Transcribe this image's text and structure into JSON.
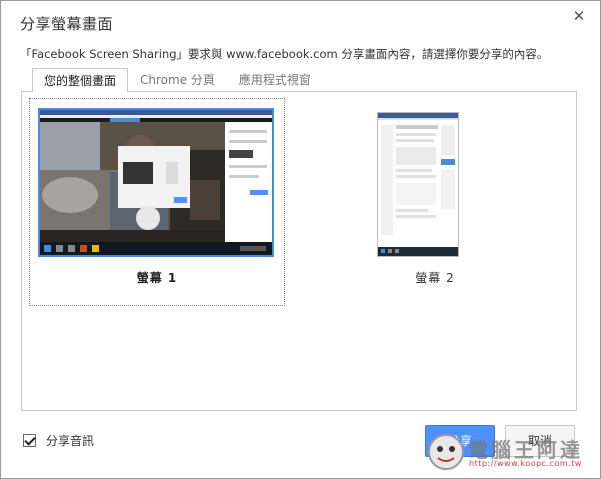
{
  "dialog": {
    "title": "分享螢幕畫面",
    "description": "「Facebook Screen Sharing」要求與 www.facebook.com 分享畫面內容，請選擇你要分享的內容。"
  },
  "tabs": [
    {
      "label": "您的整個畫面"
    },
    {
      "label": "Chrome 分頁"
    },
    {
      "label": "應用程式視窗"
    }
  ],
  "screens": [
    {
      "label": "螢幕 1"
    },
    {
      "label": "螢幕 2"
    }
  ],
  "footer": {
    "share_audio_label": "分享音訊",
    "share_audio_checked": true,
    "share_button": "分享",
    "cancel_button": "取消"
  },
  "watermark": {
    "text": "電腦王阿達",
    "url": "http://www.koopc.com.tw"
  },
  "colors": {
    "accent": "#4d90fe",
    "selected_border": "#4a8ad8"
  }
}
